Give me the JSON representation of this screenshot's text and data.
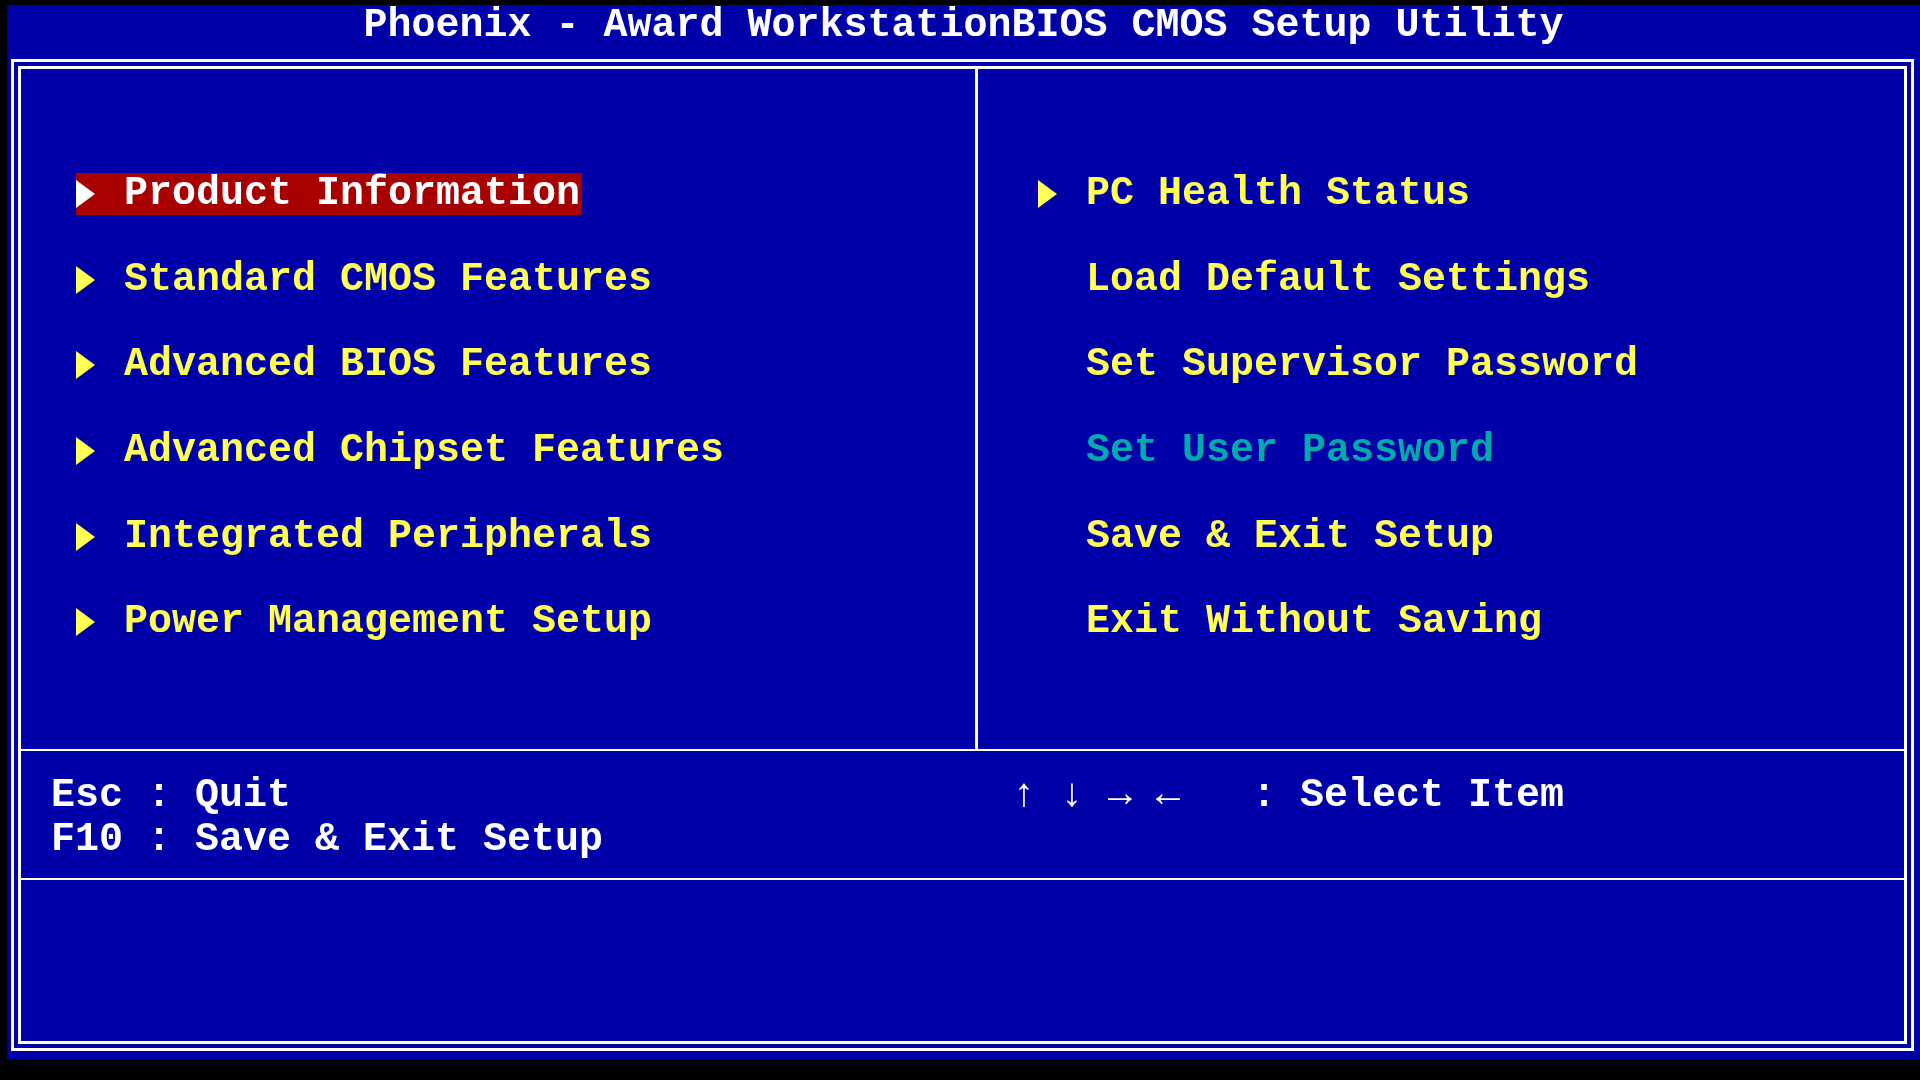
{
  "window": {
    "title": "Phoenix - Award WorkstationBIOS CMOS Setup Utility"
  },
  "left_menu": [
    {
      "label": "Product Information",
      "submenu": true,
      "selected": true,
      "disabled": false
    },
    {
      "label": "Standard CMOS Features",
      "submenu": true,
      "selected": false,
      "disabled": false
    },
    {
      "label": "Advanced BIOS Features",
      "submenu": true,
      "selected": false,
      "disabled": false
    },
    {
      "label": "Advanced Chipset Features",
      "submenu": true,
      "selected": false,
      "disabled": false
    },
    {
      "label": "Integrated Peripherals",
      "submenu": true,
      "selected": false,
      "disabled": false
    },
    {
      "label": "Power Management Setup",
      "submenu": true,
      "selected": false,
      "disabled": false
    }
  ],
  "right_menu": [
    {
      "label": "PC Health Status",
      "submenu": true,
      "selected": false,
      "disabled": false
    },
    {
      "label": "Load Default Settings",
      "submenu": false,
      "selected": false,
      "disabled": false
    },
    {
      "label": "Set Supervisor Password",
      "submenu": false,
      "selected": false,
      "disabled": false
    },
    {
      "label": "Set User Password",
      "submenu": false,
      "selected": false,
      "disabled": true
    },
    {
      "label": "Save & Exit Setup",
      "submenu": false,
      "selected": false,
      "disabled": false
    },
    {
      "label": "Exit Without Saving",
      "submenu": false,
      "selected": false,
      "disabled": false
    }
  ],
  "key_hints_left": [
    "Esc : Quit",
    "F10 : Save & Exit Setup"
  ],
  "key_hints_right": [
    "↑ ↓ → ←   : Select Item"
  ]
}
